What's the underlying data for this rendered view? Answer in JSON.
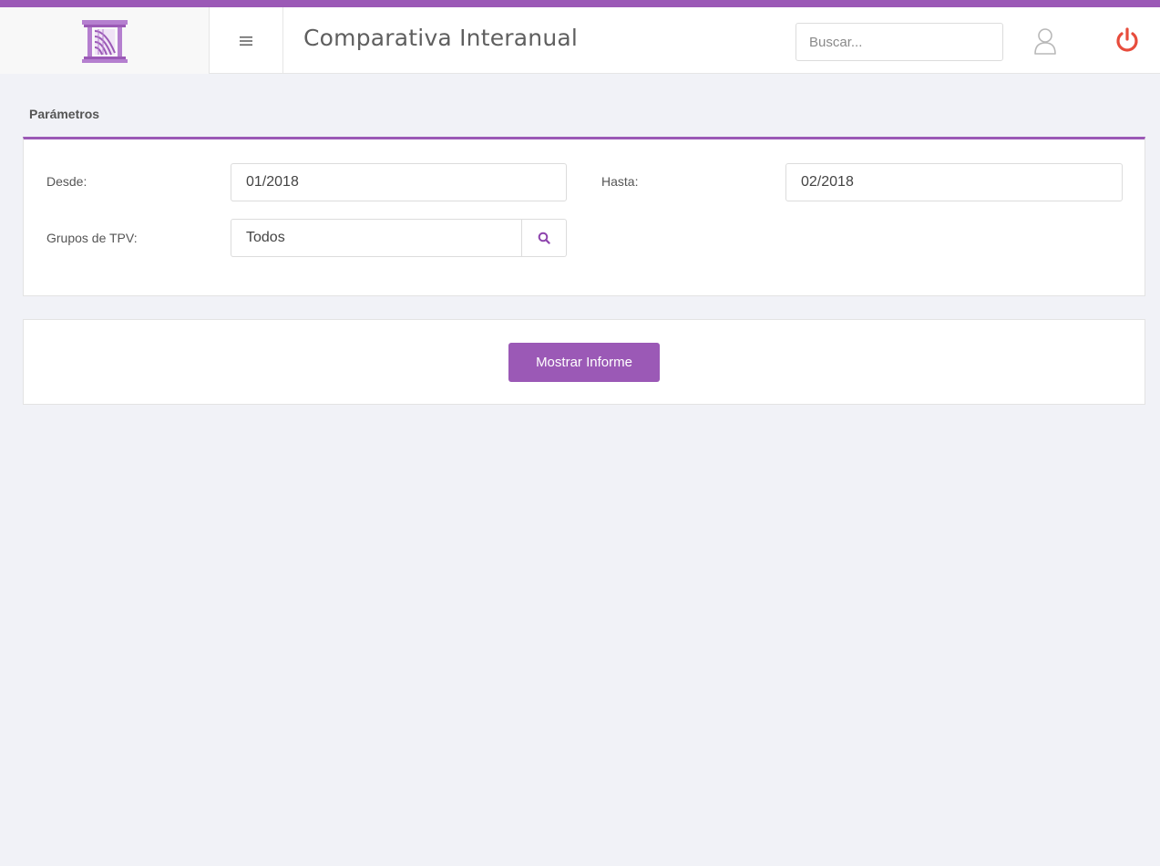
{
  "header": {
    "title": "Comparativa Interanual",
    "search_placeholder": "Buscar...",
    "logo_icon": "building-columns-logo-icon",
    "menu_icon": "hamburger-menu-icon",
    "user_icon": "user-icon",
    "power_icon": "power-icon"
  },
  "params": {
    "heading": "Parámetros",
    "desde_label": "Desde:",
    "desde_value": "01/2018",
    "hasta_label": "Hasta:",
    "hasta_value": "02/2018",
    "grupos_label": "Grupos de TPV:",
    "grupos_value": "Todos",
    "grupos_search_icon": "search-icon"
  },
  "actions": {
    "show_report_label": "Mostrar Informe"
  },
  "colors": {
    "accent": "#9b59b6",
    "power": "#e74c3c",
    "background": "#f1f2f7"
  }
}
